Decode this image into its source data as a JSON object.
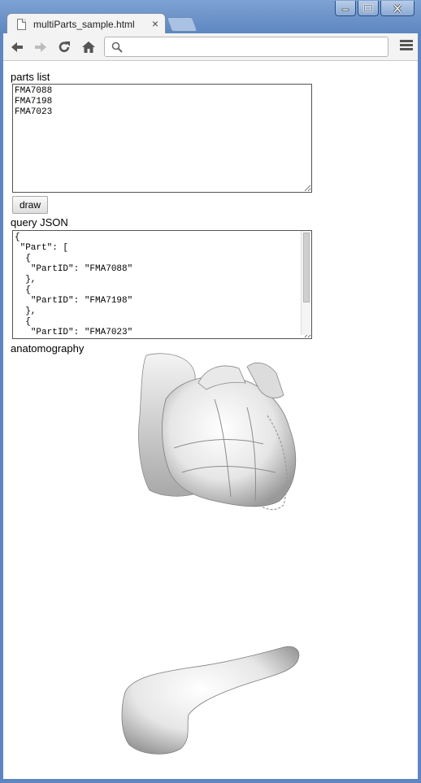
{
  "browser": {
    "tab_title": "multiParts_sample.html",
    "tab_close": "×",
    "address_value": "",
    "icons": {
      "back": "arrow-left",
      "forward": "arrow-right",
      "reload": "reload",
      "home": "home",
      "search": "magnifier",
      "menu": "hamburger-menu"
    }
  },
  "page": {
    "parts_list_label": "parts list",
    "parts_list_value": "FMA7088\nFMA7198\nFMA7023",
    "draw_button_label": "draw",
    "query_json_label": "query JSON",
    "query_json_value": "{\n \"Part\": [\n  {\n   \"PartID\": \"FMA7088\"\n  },\n  {\n   \"PartID\": \"FMA7198\"\n  },\n  {\n   \"PartID\": \"FMA7023\"\n  }\n ]\n}",
    "anatomography_label": "anatomography"
  },
  "colors": {
    "window_frame": "#6f93c7",
    "toolbar": "#f3f3f3",
    "page_background": "#ffffff"
  }
}
